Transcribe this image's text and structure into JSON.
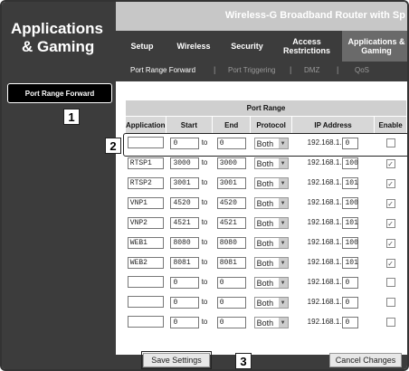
{
  "brand": {
    "line1": "Applications",
    "line2": "& Gaming"
  },
  "product_name": "Wireless-G Broadband Router with Sp",
  "tabs": [
    {
      "label": "Setup"
    },
    {
      "label": "Wireless"
    },
    {
      "label": "Security"
    },
    {
      "label": "Access Restrictions"
    },
    {
      "label": "Applications & Gaming"
    }
  ],
  "subtabs": [
    {
      "label": "Port Range Forward"
    },
    {
      "label": "Port Triggering"
    },
    {
      "label": "DMZ"
    },
    {
      "label": "QoS"
    }
  ],
  "section_label": "Port Range Forward",
  "table": {
    "title": "Port Range",
    "headers": [
      "Application",
      "Start",
      "End",
      "Protocol",
      "IP Address",
      "Enable"
    ],
    "to_label": "to",
    "ip_prefix": "192.168.1.",
    "rows": [
      {
        "app": "",
        "start": "0",
        "end": "0",
        "protocol": "Both",
        "ip": "0",
        "enabled": false
      },
      {
        "app": "RTSP1",
        "start": "3000",
        "end": "3000",
        "protocol": "Both",
        "ip": "100",
        "enabled": true
      },
      {
        "app": "RTSP2",
        "start": "3001",
        "end": "3001",
        "protocol": "Both",
        "ip": "101",
        "enabled": true
      },
      {
        "app": "VNP1",
        "start": "4520",
        "end": "4520",
        "protocol": "Both",
        "ip": "100",
        "enabled": true
      },
      {
        "app": "VNP2",
        "start": "4521",
        "end": "4521",
        "protocol": "Both",
        "ip": "101",
        "enabled": true
      },
      {
        "app": "WEB1",
        "start": "8080",
        "end": "8080",
        "protocol": "Both",
        "ip": "100",
        "enabled": true
      },
      {
        "app": "WEB2",
        "start": "8081",
        "end": "8081",
        "protocol": "Both",
        "ip": "101",
        "enabled": true
      },
      {
        "app": "",
        "start": "0",
        "end": "0",
        "protocol": "Both",
        "ip": "0",
        "enabled": false
      },
      {
        "app": "",
        "start": "0",
        "end": "0",
        "protocol": "Both",
        "ip": "0",
        "enabled": false
      },
      {
        "app": "",
        "start": "0",
        "end": "0",
        "protocol": "Both",
        "ip": "0",
        "enabled": false
      }
    ]
  },
  "buttons": {
    "save": "Save Settings",
    "cancel": "Cancel Changes"
  },
  "callouts": [
    "1",
    "2",
    "3"
  ],
  "colors": {
    "dark": "#3c3c3c",
    "header_gray": "#d7d7d7"
  }
}
